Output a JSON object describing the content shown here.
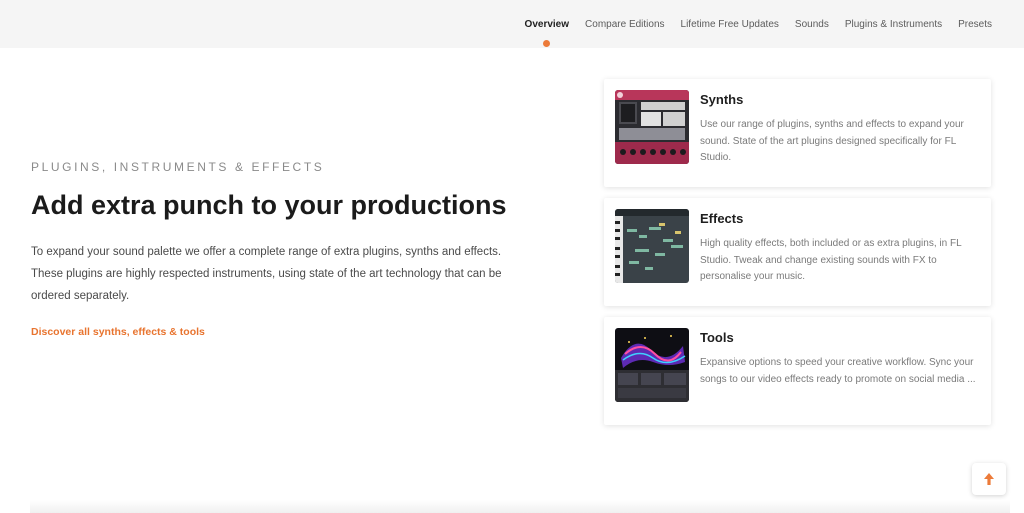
{
  "nav": {
    "items": [
      {
        "label": "Overview",
        "active": true
      },
      {
        "label": "Compare Editions",
        "active": false
      },
      {
        "label": "Lifetime Free Updates",
        "active": false
      },
      {
        "label": "Sounds",
        "active": false
      },
      {
        "label": "Plugins & Instruments",
        "active": false
      },
      {
        "label": "Presets",
        "active": false
      }
    ]
  },
  "intro": {
    "eyebrow": "PLUGINS, INSTRUMENTS & EFFECTS",
    "headline": "Add extra punch to your productions",
    "body": "To expand your sound palette we offer a complete range of extra plugins, synths and effects. These plugins are highly respected instruments, using state of the art technology that can be ordered separately.",
    "link": "Discover all synths, effects & tools"
  },
  "cards": [
    {
      "title": "Synths",
      "description": "Use our range of plugins, synths and effects to expand your sound. State of the art plugins designed specifically for FL Studio.",
      "thumb": "synth-plugin-screenshot"
    },
    {
      "title": "Effects",
      "description": "High quality effects, both included or as extra plugins, in FL Studio. Tweak and change existing sounds with FX to personalise your music.",
      "thumb": "effects-plugin-screenshot"
    },
    {
      "title": "Tools",
      "description": "Expansive options to speed your creative workflow. Sync your songs to our video effects ready to promote on social media ...",
      "thumb": "video-tool-screenshot"
    }
  ],
  "colors": {
    "accent": "#ec7b3a",
    "link": "#e8742f",
    "topbar": "#f5f5f5"
  },
  "icons": {
    "back_to_top": "arrow-up-icon"
  }
}
